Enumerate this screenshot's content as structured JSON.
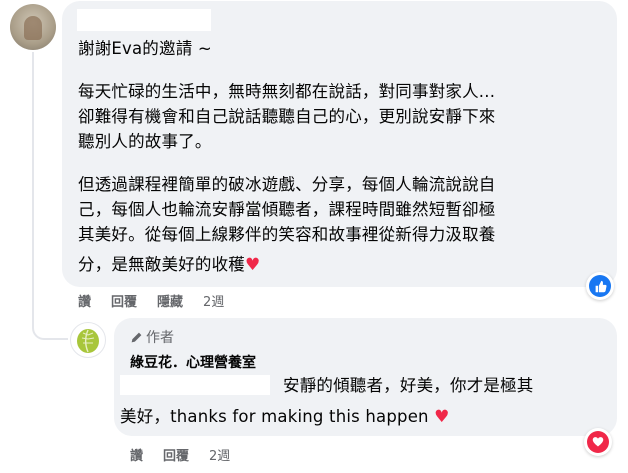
{
  "comment": {
    "mention_line": "謝謝Eva的邀請 ~",
    "paragraph1": [
      "每天忙碌的生活中，無時無刻都在說話，對同事對家人...",
      "卻難得有機會和自己說話聽聽自己的心，更別說安靜下來",
      "聽別人的故事了。"
    ],
    "paragraph2": [
      "但透過課程裡簡單的破冰遊戲、分享，每個人輪流說說自",
      "己，每個人也輪流安靜當傾聽者，課程時間雖然短暫卻極",
      "其美好。從每個上線夥伴的笑容和故事裡從新得力汲取養",
      "分，是無敵美好的收穫"
    ],
    "heart_emoji": "♥",
    "reaction_icon": "thumbs-up-icon",
    "actions": {
      "like": "讚",
      "reply": "回覆",
      "hide": "隱藏",
      "time": "2週"
    }
  },
  "reply": {
    "author_badge": "作者",
    "author_name": "綠豆花．心理營養室",
    "line1": "安靜的傾聽者，好美，你才是極其",
    "line2": "美好，thanks for making this happen",
    "heart_emoji": "♥",
    "reaction_icon": "love-icon",
    "actions": {
      "like": "讚",
      "reply": "回覆",
      "time": "2週"
    }
  },
  "colors": {
    "bubble": "#f0f2f5",
    "secondary_text": "#65676b",
    "like_blue": "#1877f2",
    "love_red": "#f02849",
    "avatar_green": "#a8c63b"
  }
}
